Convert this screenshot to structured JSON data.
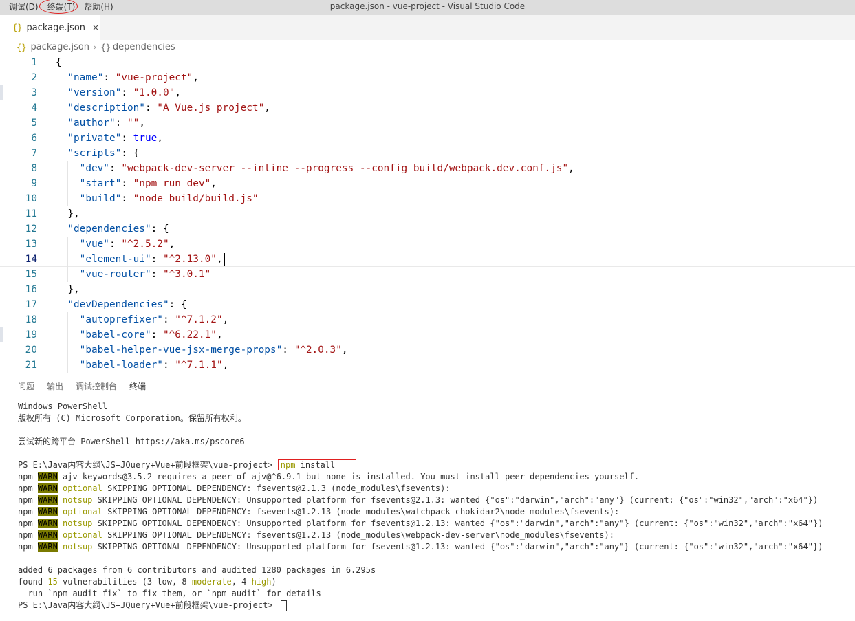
{
  "window": {
    "title": "package.json - vue-project - Visual Studio Code",
    "menu": [
      "调试(D)",
      "终端(T)",
      "帮助(H)"
    ]
  },
  "tab": {
    "icon": "{}",
    "label": "package.json",
    "close": "×"
  },
  "breadcrumb": {
    "icon": "{}",
    "file": "package.json",
    "sep": "›",
    "symbol_icon": "{}",
    "symbol": "dependencies"
  },
  "editor": {
    "current_line": 14,
    "lines": [
      {
        "n": "1",
        "segs": [
          [
            "p",
            "{"
          ]
        ]
      },
      {
        "n": "2",
        "segs": [
          [
            "k",
            "  \"name\""
          ],
          [
            "p",
            ": "
          ],
          [
            "s",
            "\"vue-project\""
          ],
          [
            "p",
            ","
          ]
        ]
      },
      {
        "n": "3",
        "segs": [
          [
            "k",
            "  \"version\""
          ],
          [
            "p",
            ": "
          ],
          [
            "s",
            "\"1.0.0\""
          ],
          [
            "p",
            ","
          ]
        ]
      },
      {
        "n": "4",
        "segs": [
          [
            "k",
            "  \"description\""
          ],
          [
            "p",
            ": "
          ],
          [
            "s",
            "\"A Vue.js project\""
          ],
          [
            "p",
            ","
          ]
        ]
      },
      {
        "n": "5",
        "segs": [
          [
            "k",
            "  \"author\""
          ],
          [
            "p",
            ": "
          ],
          [
            "s",
            "\"\""
          ],
          [
            "p",
            ","
          ]
        ]
      },
      {
        "n": "6",
        "segs": [
          [
            "k",
            "  \"private\""
          ],
          [
            "p",
            ": "
          ],
          [
            "b",
            "true"
          ],
          [
            "p",
            ","
          ]
        ]
      },
      {
        "n": "7",
        "segs": [
          [
            "k",
            "  \"scripts\""
          ],
          [
            "p",
            ": {"
          ]
        ]
      },
      {
        "n": "8",
        "segs": [
          [
            "k",
            "    \"dev\""
          ],
          [
            "p",
            ": "
          ],
          [
            "s",
            "\"webpack-dev-server --inline --progress --config build/webpack.dev.conf.js\""
          ],
          [
            "p",
            ","
          ]
        ]
      },
      {
        "n": "9",
        "segs": [
          [
            "k",
            "    \"start\""
          ],
          [
            "p",
            ": "
          ],
          [
            "s",
            "\"npm run dev\""
          ],
          [
            "p",
            ","
          ]
        ]
      },
      {
        "n": "10",
        "segs": [
          [
            "k",
            "    \"build\""
          ],
          [
            "p",
            ": "
          ],
          [
            "s",
            "\"node build/build.js\""
          ]
        ]
      },
      {
        "n": "11",
        "segs": [
          [
            "p",
            "  },"
          ]
        ]
      },
      {
        "n": "12",
        "segs": [
          [
            "k",
            "  \"dependencies\""
          ],
          [
            "p",
            ": {"
          ]
        ]
      },
      {
        "n": "13",
        "segs": [
          [
            "k",
            "    \"vue\""
          ],
          [
            "p",
            ": "
          ],
          [
            "s",
            "\"^2.5.2\""
          ],
          [
            "p",
            ","
          ]
        ]
      },
      {
        "n": "14",
        "segs": [
          [
            "k",
            "    \"element-ui\""
          ],
          [
            "p",
            ": "
          ],
          [
            "s",
            "\"^2.13.0\""
          ],
          [
            "p",
            ","
          ]
        ]
      },
      {
        "n": "15",
        "segs": [
          [
            "k",
            "    \"vue-router\""
          ],
          [
            "p",
            ": "
          ],
          [
            "s",
            "\"^3.0.1\""
          ]
        ]
      },
      {
        "n": "16",
        "segs": [
          [
            "p",
            "  },"
          ]
        ]
      },
      {
        "n": "17",
        "segs": [
          [
            "k",
            "  \"devDependencies\""
          ],
          [
            "p",
            ": {"
          ]
        ]
      },
      {
        "n": "18",
        "segs": [
          [
            "k",
            "    \"autoprefixer\""
          ],
          [
            "p",
            ": "
          ],
          [
            "s",
            "\"^7.1.2\""
          ],
          [
            "p",
            ","
          ]
        ]
      },
      {
        "n": "19",
        "segs": [
          [
            "k",
            "    \"babel-core\""
          ],
          [
            "p",
            ": "
          ],
          [
            "s",
            "\"^6.22.1\""
          ],
          [
            "p",
            ","
          ]
        ]
      },
      {
        "n": "20",
        "segs": [
          [
            "k",
            "    \"babel-helper-vue-jsx-merge-props\""
          ],
          [
            "p",
            ": "
          ],
          [
            "s",
            "\"^2.0.3\""
          ],
          [
            "p",
            ","
          ]
        ]
      },
      {
        "n": "21",
        "segs": [
          [
            "k",
            "    \"babel-loader\""
          ],
          [
            "p",
            ": "
          ],
          [
            "s",
            "\"^7.1.1\""
          ],
          [
            "p",
            ","
          ]
        ]
      }
    ]
  },
  "panel": {
    "tabs": [
      "问题",
      "输出",
      "调试控制台",
      "终端"
    ],
    "active_tab": "终端"
  },
  "terminal": {
    "lines": [
      [
        [
          "t",
          "Windows PowerShell"
        ]
      ],
      [
        [
          "t",
          "版权所有 (C) Microsoft Corporation。保留所有权利。"
        ]
      ],
      [],
      [
        [
          "t",
          "尝试新的跨平台 PowerShell https://aka.ms/pscore6"
        ]
      ],
      [],
      [
        [
          "t",
          "PS E:\\Java内容大纲\\JS+JQuery+Vue+前段框架\\vue-project> "
        ],
        [
          "cmd",
          "npm",
          " install"
        ]
      ],
      [
        [
          "t",
          "npm "
        ],
        [
          "w",
          "WARN"
        ],
        [
          "t",
          " ajv-keywords@3.5.2 requires a peer of ajv@^6.9.1 but none is installed. You must install peer dependencies yourself."
        ]
      ],
      [
        [
          "t",
          "npm "
        ],
        [
          "w",
          "WARN"
        ],
        [
          "t",
          " "
        ],
        [
          "y",
          "optional"
        ],
        [
          "t",
          " SKIPPING OPTIONAL DEPENDENCY: fsevents@2.1.3 (node_modules\\fsevents):"
        ]
      ],
      [
        [
          "t",
          "npm "
        ],
        [
          "w",
          "WARN"
        ],
        [
          "t",
          " "
        ],
        [
          "y",
          "notsup"
        ],
        [
          "t",
          " SKIPPING OPTIONAL DEPENDENCY: Unsupported platform for fsevents@2.1.3: wanted {\"os\":\"darwin\",\"arch\":\"any\"} (current: {\"os\":\"win32\",\"arch\":\"x64\"})"
        ]
      ],
      [
        [
          "t",
          "npm "
        ],
        [
          "w",
          "WARN"
        ],
        [
          "t",
          " "
        ],
        [
          "y",
          "optional"
        ],
        [
          "t",
          " SKIPPING OPTIONAL DEPENDENCY: fsevents@1.2.13 (node_modules\\watchpack-chokidar2\\node_modules\\fsevents):"
        ]
      ],
      [
        [
          "t",
          "npm "
        ],
        [
          "w",
          "WARN"
        ],
        [
          "t",
          " "
        ],
        [
          "y",
          "notsup"
        ],
        [
          "t",
          " SKIPPING OPTIONAL DEPENDENCY: Unsupported platform for fsevents@1.2.13: wanted {\"os\":\"darwin\",\"arch\":\"any\"} (current: {\"os\":\"win32\",\"arch\":\"x64\"})"
        ]
      ],
      [
        [
          "t",
          "npm "
        ],
        [
          "w",
          "WARN"
        ],
        [
          "t",
          " "
        ],
        [
          "y",
          "optional"
        ],
        [
          "t",
          " SKIPPING OPTIONAL DEPENDENCY: fsevents@1.2.13 (node_modules\\webpack-dev-server\\node_modules\\fsevents):"
        ]
      ],
      [
        [
          "t",
          "npm "
        ],
        [
          "w",
          "WARN"
        ],
        [
          "t",
          " "
        ],
        [
          "y",
          "notsup"
        ],
        [
          "t",
          " SKIPPING OPTIONAL DEPENDENCY: Unsupported platform for fsevents@1.2.13: wanted {\"os\":\"darwin\",\"arch\":\"any\"} (current: {\"os\":\"win32\",\"arch\":\"x64\"})"
        ]
      ],
      [],
      [
        [
          "t",
          "added 6 packages from 6 contributors and audited 1280 packages in 6.295s"
        ]
      ],
      [
        [
          "t",
          "found "
        ],
        [
          "y",
          "15"
        ],
        [
          "t",
          " vulnerabilities (3 low, 8 "
        ],
        [
          "y",
          "moderate"
        ],
        [
          "t",
          ", 4 "
        ],
        [
          "y",
          "high"
        ],
        [
          "t",
          ")"
        ]
      ],
      [
        [
          "t",
          "  run `npm audit fix` to fix them, or `npm audit` for details"
        ]
      ],
      [
        [
          "t",
          "PS E:\\Java内容大纲\\JS+JQuery+Vue+前段框架\\vue-project> "
        ],
        [
          "cursor",
          ""
        ]
      ]
    ]
  }
}
